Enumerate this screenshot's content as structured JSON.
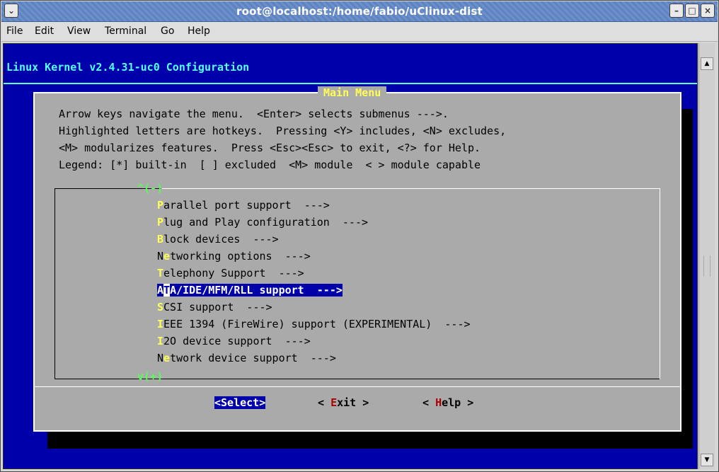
{
  "window": {
    "title": "root@localhost:/home/fabio/uClinux-dist"
  },
  "menubar": [
    {
      "label": "File"
    },
    {
      "label": "Edit"
    },
    {
      "label": "View"
    },
    {
      "label": "Terminal"
    },
    {
      "label": "Go"
    },
    {
      "label": "Help"
    }
  ],
  "terminal": {
    "config_title": "Linux Kernel v2.4.31-uc0 Configuration",
    "dialog_title": "Main Menu",
    "help_lines": [
      "Arrow keys navigate the menu.  <Enter> selects submenus --->.",
      "Highlighted letters are hotkeys.  Pressing <Y> includes, <N> excludes,",
      "<M> modularizes features.  Press <Esc><Esc> to exit, <?> for Help.",
      "Legend: [*] built-in  [ ] excluded  <M> module  < > module capable"
    ],
    "scroll_up": "^(-)",
    "scroll_down": "v(+)",
    "menu_items": [
      {
        "hotkey": "P",
        "rest": "arallel port support  --->"
      },
      {
        "hotkey": "P",
        "rest": "lug and Play configuration  --->"
      },
      {
        "hotkey": "B",
        "rest": "lock devices  --->"
      },
      {
        "pre": "N",
        "hotkey": "e",
        "rest": "tworking options  --->"
      },
      {
        "hotkey": "T",
        "rest": "elephony Support  --->"
      },
      {
        "pre": "A",
        "hotkey": "T",
        "rest": "A/IDE/MFM/RLL support  --->",
        "selected": true
      },
      {
        "hotkey": "S",
        "rest": "CSI support  --->"
      },
      {
        "hotkey": "I",
        "rest": "EEE 1394 (FireWire) support (EXPERIMENTAL)  --->"
      },
      {
        "hotkey": "I",
        "rest": "2O device support  --->"
      },
      {
        "pre": "N",
        "hotkey": "e",
        "rest": "twork device support  --->"
      }
    ],
    "buttons": {
      "select": "<Select>",
      "exit_pre": "< ",
      "exit_hotkey": "E",
      "exit_rest": "xit >",
      "help_pre": "< ",
      "help_hotkey": "H",
      "help_rest": "elp >"
    }
  }
}
